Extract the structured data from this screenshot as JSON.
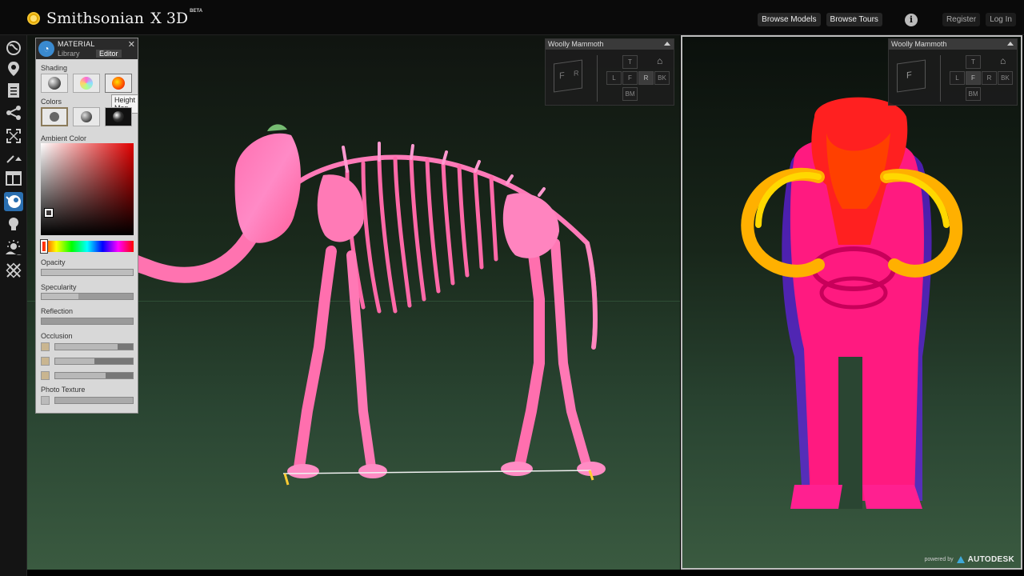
{
  "brand": {
    "name": "Smithsonian",
    "x3d": "X 3D",
    "beta": "BETA"
  },
  "nav": {
    "browse_models": "Browse Models",
    "browse_tours": "Browse Tours",
    "info": "i",
    "register": "Register",
    "login": "Log In"
  },
  "tools": [
    "globe-icon",
    "location-pin-icon",
    "document-icon",
    "share-icon",
    "fullscreen-icon",
    "measure-icon",
    "layout-icon",
    "material-icon",
    "lightbulb-icon",
    "scene-icon",
    "cross-section-icon"
  ],
  "material": {
    "title": "MATERIAL",
    "tabs": {
      "library": "Library",
      "editor": "Editor"
    },
    "shading": "Shading",
    "colors": "Colors",
    "ambient_color": "Ambient Color",
    "opacity": "Opacity",
    "specularity": "Specularity",
    "reflection": "Reflection",
    "occlusion": "Occlusion",
    "photo_texture": "Photo Texture",
    "tooltip": "Height Map",
    "values": {
      "opacity": 1.0,
      "specularity": 0.4,
      "reflection": 0.0,
      "occlusion": [
        0.8,
        0.5,
        0.65
      ],
      "photo_texture": 0.0
    }
  },
  "viewer_left": {
    "title": "Woolly Mammoth",
    "cube": [
      "F",
      "R"
    ],
    "views": [
      "T",
      "L",
      "F",
      "R",
      "BK",
      "BM"
    ]
  },
  "viewer_right": {
    "title": "Woolly Mammoth",
    "cube": [
      "F"
    ],
    "views": [
      "T",
      "L",
      "F",
      "R",
      "BK",
      "BM"
    ]
  },
  "footer": {
    "powered": "powered by",
    "brand": "AUTODESK"
  },
  "colors": {
    "accent": "#2a6fb0",
    "skeleton_left": "#ff5fa0",
    "skeleton_right": "#ff1a6a",
    "tusk": "#ffc400"
  }
}
